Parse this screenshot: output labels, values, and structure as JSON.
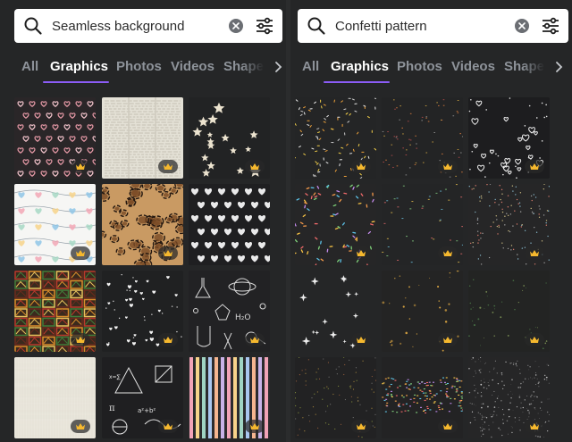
{
  "left_panel": {
    "search": {
      "query": "Seamless background",
      "search_icon": "search-icon",
      "clear_icon": "clear-icon",
      "filter_icon": "filter-icon"
    },
    "tabs": [
      {
        "label": "All",
        "active": false
      },
      {
        "label": "Graphics",
        "active": true
      },
      {
        "label": "Photos",
        "active": false
      },
      {
        "label": "Videos",
        "active": false
      },
      {
        "label": "Shapes",
        "active": false
      }
    ],
    "thumbnails": [
      {
        "pattern": "pink-hearts-on-dark",
        "premium": true
      },
      {
        "pattern": "newspaper-texture",
        "premium": true
      },
      {
        "pattern": "cream-stars-on-dark",
        "premium": true
      },
      {
        "pattern": "pastel-hearts-string",
        "premium": true
      },
      {
        "pattern": "leopard-print",
        "premium": true
      },
      {
        "pattern": "white-hearts-on-dark",
        "premium": false
      },
      {
        "pattern": "african-tribal",
        "premium": true
      },
      {
        "pattern": "tiny-hearts-on-dark",
        "premium": true
      },
      {
        "pattern": "science-doodles",
        "premium": true
      },
      {
        "pattern": "linen-texture",
        "premium": true
      },
      {
        "pattern": "math-doodles",
        "premium": true
      },
      {
        "pattern": "pastel-stripes",
        "premium": true
      }
    ]
  },
  "right_panel": {
    "search": {
      "query": "Confetti pattern",
      "search_icon": "search-icon",
      "clear_icon": "clear-icon",
      "filter_icon": "filter-icon"
    },
    "tabs": [
      {
        "label": "All",
        "active": false
      },
      {
        "label": "Graphics",
        "active": true
      },
      {
        "label": "Photos",
        "active": false
      },
      {
        "label": "Videos",
        "active": false
      },
      {
        "label": "Shapes",
        "active": false
      }
    ],
    "thumbnails": [
      {
        "pattern": "sprinkles-confetti",
        "premium": true
      },
      {
        "pattern": "fine-confetti",
        "premium": true
      },
      {
        "pattern": "white-hearts-doodle",
        "premium": true
      },
      {
        "pattern": "colorful-sprinkles",
        "premium": true
      },
      {
        "pattern": "sparse-confetti",
        "premium": true
      },
      {
        "pattern": "dotted-confetti",
        "premium": true
      },
      {
        "pattern": "white-sparkles",
        "premium": true
      },
      {
        "pattern": "gold-sparkles",
        "premium": true
      },
      {
        "pattern": "green-sparkles",
        "premium": true
      },
      {
        "pattern": "glitter-band",
        "premium": true
      },
      {
        "pattern": "rainbow-glitter",
        "premium": true
      },
      {
        "pattern": "silver-glitter",
        "premium": true
      }
    ]
  },
  "colors": {
    "background": "#252627",
    "accent": "#8b5cf6",
    "tab_inactive": "#8e939a",
    "crown": "#f5b82e"
  }
}
